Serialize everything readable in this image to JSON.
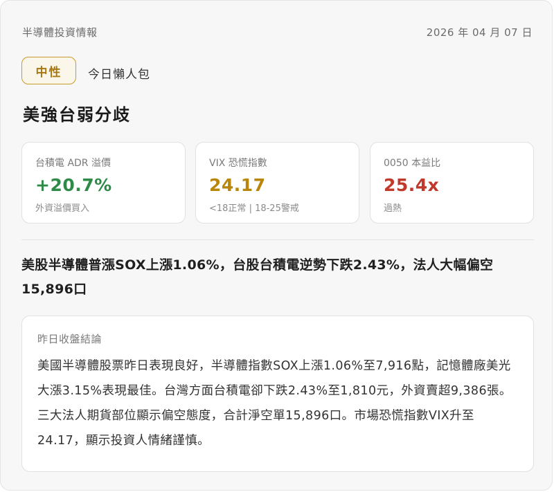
{
  "header": {
    "source": "半導體投資情報",
    "date": "2026 年 04 月 07 日"
  },
  "badge": {
    "sentiment": "中性",
    "caption": "今日懶人包"
  },
  "headline": "美強台弱分歧",
  "metrics": [
    {
      "label": "台積電 ADR 溢價",
      "value": "+20.7%",
      "note": "外資溢價買入",
      "color": "#2e8b47"
    },
    {
      "label": "VIX 恐慌指數",
      "value": "24.17",
      "note": "<18正常 | 18-25警戒",
      "color": "#b8860b"
    },
    {
      "label": "0050 本益比",
      "value": "25.4x",
      "note": "過熱",
      "color": "#c0392b"
    }
  ],
  "summary": "美股半導體普漲SOX上漲1.06%，台股台積電逆勢下跌2.43%，法人大幅偏空15,896口",
  "conclusion": {
    "title": "昨日收盤結論",
    "body": "美國半導體股票昨日表現良好，半導體指數SOX上漲1.06%至7,916點，記憶體廠美光大漲3.15%表現最佳。台灣方面台積電卻下跌2.43%至1,810元，外資賣超9,386張。三大法人期貨部位顯示偏空態度，合計淨空單15,896口。市場恐慌指數VIX升至24.17，顯示投資人情緒謹慎。"
  }
}
